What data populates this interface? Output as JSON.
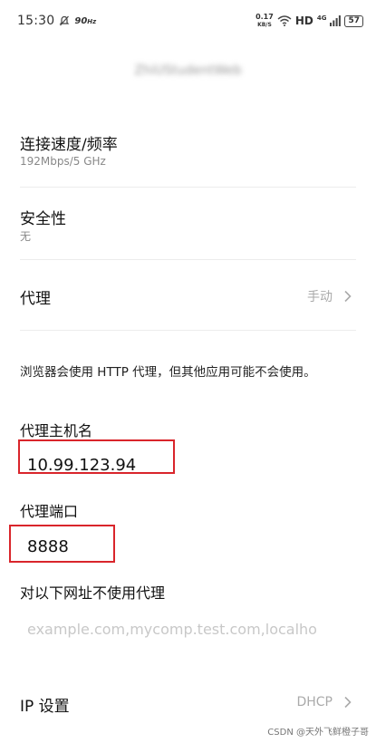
{
  "status_bar": {
    "time": "15:30",
    "refresh_rate": "90",
    "refresh_unit": "Hz",
    "net_speed_value": "0.17",
    "net_speed_unit": "KB/S",
    "network_type": "HD",
    "signal_gen": "4G",
    "battery": "57"
  },
  "network_name": "ZhiUStudentWeb",
  "rows": {
    "connection_speed": {
      "title": "连接速度/频率",
      "value": "192Mbps/5 GHz"
    },
    "security": {
      "title": "安全性",
      "value": "无"
    },
    "proxy": {
      "title": "代理",
      "value": "手动"
    }
  },
  "proxy_note": "浏览器会使用 HTTP 代理，但其他应用可能不会使用。",
  "proxy_host": {
    "label": "代理主机名",
    "value": "10.99.123.94"
  },
  "proxy_port": {
    "label": "代理端口",
    "value": "8888"
  },
  "bypass": {
    "label": "对以下网址不使用代理",
    "placeholder": "example.com,mycomp.test.com,localho"
  },
  "ip_settings": {
    "title": "IP 设置",
    "value": "DHCP"
  },
  "watermark": "CSDN @天外飞鲜橙子哥",
  "colors": {
    "highlight": "#d9252b",
    "secondary_text": "#aaaaaa"
  }
}
